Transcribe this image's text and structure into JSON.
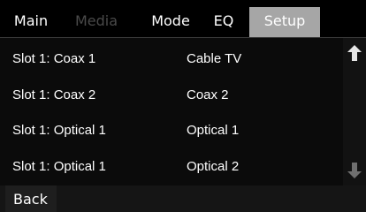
{
  "tabs": [
    {
      "label": "Main",
      "state": "enabled"
    },
    {
      "label": "Media",
      "state": "disabled"
    },
    {
      "label": "Mode",
      "state": "enabled"
    },
    {
      "label": "EQ",
      "state": "enabled"
    },
    {
      "label": "Setup",
      "state": "active"
    }
  ],
  "inputs": [
    {
      "slot": "Slot 1: Coax 1",
      "source": "Cable TV"
    },
    {
      "slot": "Slot 1: Coax 2",
      "source": "Coax 2"
    },
    {
      "slot": "Slot 1: Optical 1",
      "source": "Optical 1"
    },
    {
      "slot": "Slot 1: Optical 1",
      "source": "Optical 2"
    }
  ],
  "scroll": {
    "up_icon": "arrow-up-icon",
    "down_icon": "arrow-down-icon"
  },
  "footer": {
    "back_label": "Back"
  },
  "colors": {
    "background": "#0b0b0b",
    "active_tab": "#a6a6a6",
    "disabled_text": "#4a4a4a",
    "down_arrow": "#6f6f6f"
  }
}
